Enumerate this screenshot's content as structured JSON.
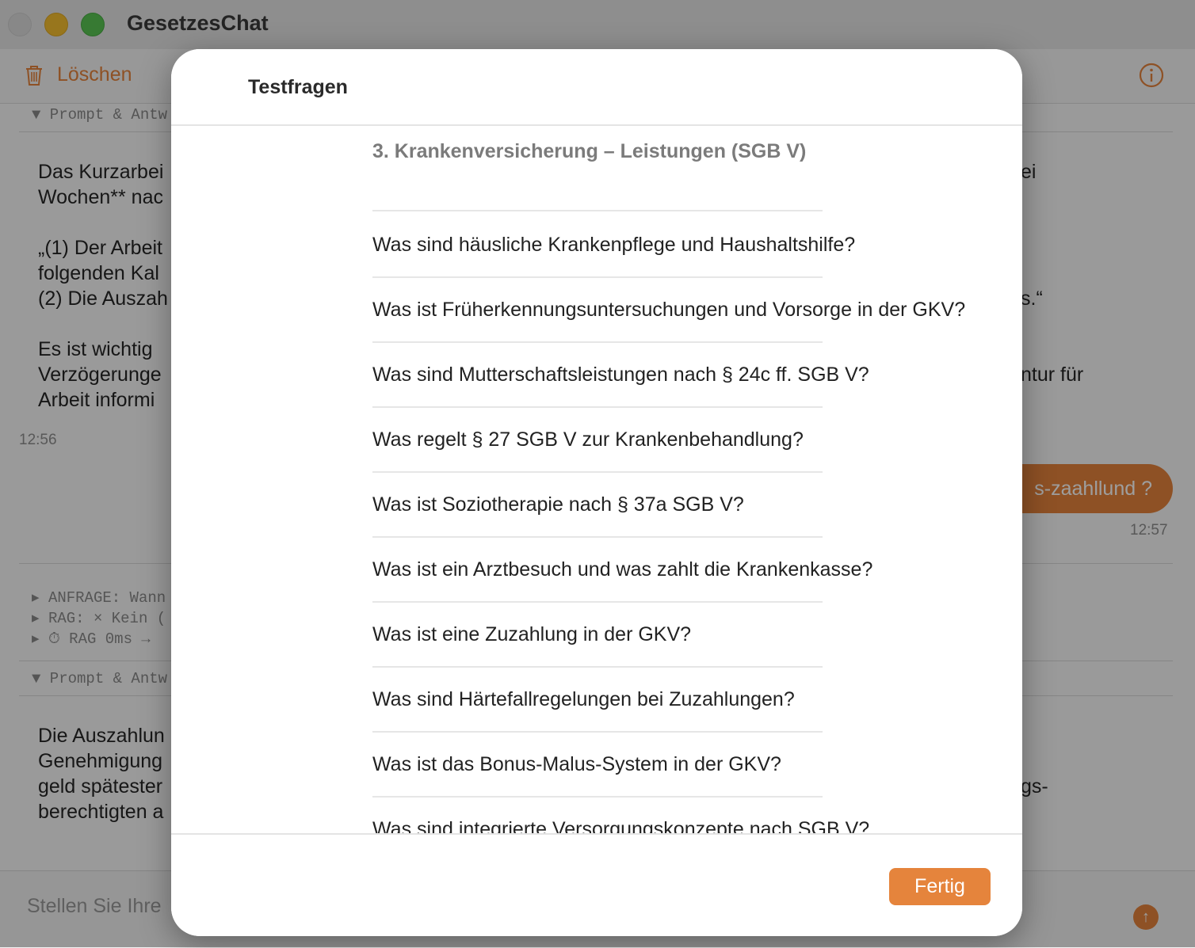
{
  "window": {
    "title": "GesetzesChat"
  },
  "toolbar": {
    "delete_label": "Löschen"
  },
  "chat": {
    "section1_header": "▼ Prompt & Antw",
    "message1_lines": [
      "Das Kurzarbei",
      "Wochen** nac",
      "",
      "„(1) Der Arbeit",
      "folgenden Kal",
      "(2) Die Auszah",
      "",
      "Es ist wichtig",
      "Verzögerunge",
      "Arbeit informi"
    ],
    "message1_right": [
      "ei",
      "s.“",
      "ntur für"
    ],
    "time1": "12:56",
    "user_bubble": "s-zaahllund ?",
    "time2": "12:57",
    "debug_lines": [
      "▸ ANFRAGE: Wann",
      "▸ RAG: × Kein (",
      "▸ ⏱ RAG 0ms →"
    ],
    "section2_header": "▼ Prompt & Antw",
    "message2_lines": [
      "Die Auszahlun",
      "Genehmigung",
      "geld spätester",
      "berechtigten a"
    ],
    "message2_right": "gs-",
    "input_placeholder": "Stellen Sie Ihre"
  },
  "sheet": {
    "title": "Testfragen",
    "section_heading": "3. Krankenversicherung – Leistungen (SGB V)",
    "questions": [
      "Was sind häusliche Krankenpflege und Haushaltshilfe?",
      "Was ist Früherkennungsuntersuchungen und Vorsorge in der GKV?",
      "Was sind Mutterschaftsleistungen nach § 24c ff. SGB V?",
      "Was regelt § 27 SGB V zur Krankenbehandlung?",
      "Was ist Soziotherapie nach § 37a SGB V?",
      "Was ist ein Arztbesuch und was zahlt die Krankenkasse?",
      "Was ist eine Zuzahlung in der GKV?",
      "Was sind Härtefallregelungen bei Zuzahlungen?",
      "Was ist das Bonus-Malus-System in der GKV?",
      "Was sind integrierte Versorgungskonzepte nach SGB V?"
    ],
    "done_label": "Fertig"
  },
  "colors": {
    "accent": "#e5843c"
  },
  "icons": {
    "delete": "trash-icon",
    "info": "info-icon",
    "send": "arrow-up-icon"
  }
}
